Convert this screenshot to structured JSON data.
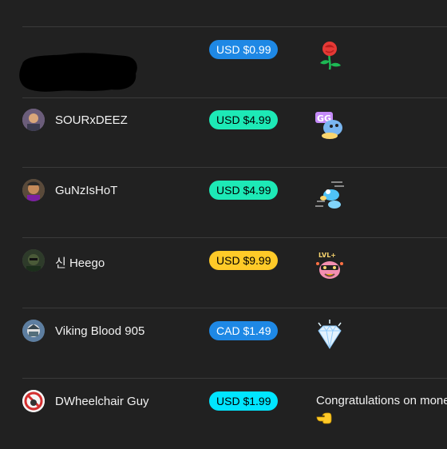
{
  "chat_items": [
    {
      "name": "",
      "avatar_icon": "redacted-name",
      "amount": "USD $0.99",
      "pill_color": "#1e88e5",
      "pill_text_color": "#ffffff",
      "sticker_icon": "rose-sticker-icon"
    },
    {
      "name": "SOURxDEEZ",
      "avatar_icon": "user-avatar",
      "amount": "USD $4.99",
      "pill_color": "#1de9b6",
      "pill_text_color": "#000000",
      "sticker_icon": "gg-sticker-icon"
    },
    {
      "name": "GuNzIsHoT",
      "avatar_icon": "user-avatar",
      "amount": "USD $4.99",
      "pill_color": "#1de9b6",
      "pill_text_color": "#000000",
      "sticker_icon": "running-sticker-icon"
    },
    {
      "name": "신 Heego",
      "avatar_icon": "user-avatar",
      "amount": "USD $9.99",
      "pill_color": "#ffca28",
      "pill_text_color": "#000000",
      "sticker_icon": "level-up-sticker-icon"
    },
    {
      "name": "Viking Blood 905",
      "avatar_icon": "user-avatar",
      "amount": "CAD $1.49",
      "pill_color": "#1e88e5",
      "pill_text_color": "#ffffff",
      "sticker_icon": "diamond-sticker-icon"
    },
    {
      "name": "DWheelchair Guy",
      "avatar_icon": "user-avatar",
      "amount": "USD $1.99",
      "pill_color": "#00e5ff",
      "pill_text_color": "#000000",
      "message": "Congratulations on mone",
      "emoji_icon": "pointing-hand-emoji-icon"
    }
  ]
}
